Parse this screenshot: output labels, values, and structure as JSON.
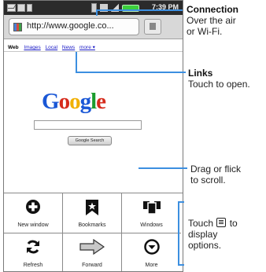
{
  "status_bar": {
    "time": "7:39 PM"
  },
  "browser": {
    "url": "http://www.google.co...",
    "nav_links": {
      "web": "Web",
      "images": "Images",
      "local": "Local",
      "news": "News",
      "more": "more ▾"
    },
    "google_logo": [
      "G",
      "o",
      "o",
      "g",
      "l",
      "e"
    ],
    "search_button": "Google Search"
  },
  "menu": {
    "items": [
      {
        "label": "New window",
        "icon": "plus-circle-icon"
      },
      {
        "label": "Bookmarks",
        "icon": "bookmark-icon"
      },
      {
        "label": "Windows",
        "icon": "windows-icon"
      },
      {
        "label": "Refresh",
        "icon": "refresh-icon"
      },
      {
        "label": "Forward",
        "icon": "forward-arrow-icon"
      },
      {
        "label": "More",
        "icon": "more-chevron-icon"
      }
    ]
  },
  "callouts": {
    "connection_title": "Connection",
    "connection_line1": "Over the air",
    "connection_line2": "or Wi-Fi.",
    "links_title": "Links",
    "links_line1": "Touch to open.",
    "scroll_line1": "Drag or flick",
    "scroll_line2": "to scroll.",
    "menu_line1": "Touch",
    "menu_line2": "to",
    "menu_line3": "display",
    "menu_line4": "options."
  },
  "colors": {
    "callout_line": "#3c8fe0",
    "battery": "#3ccf3c"
  }
}
